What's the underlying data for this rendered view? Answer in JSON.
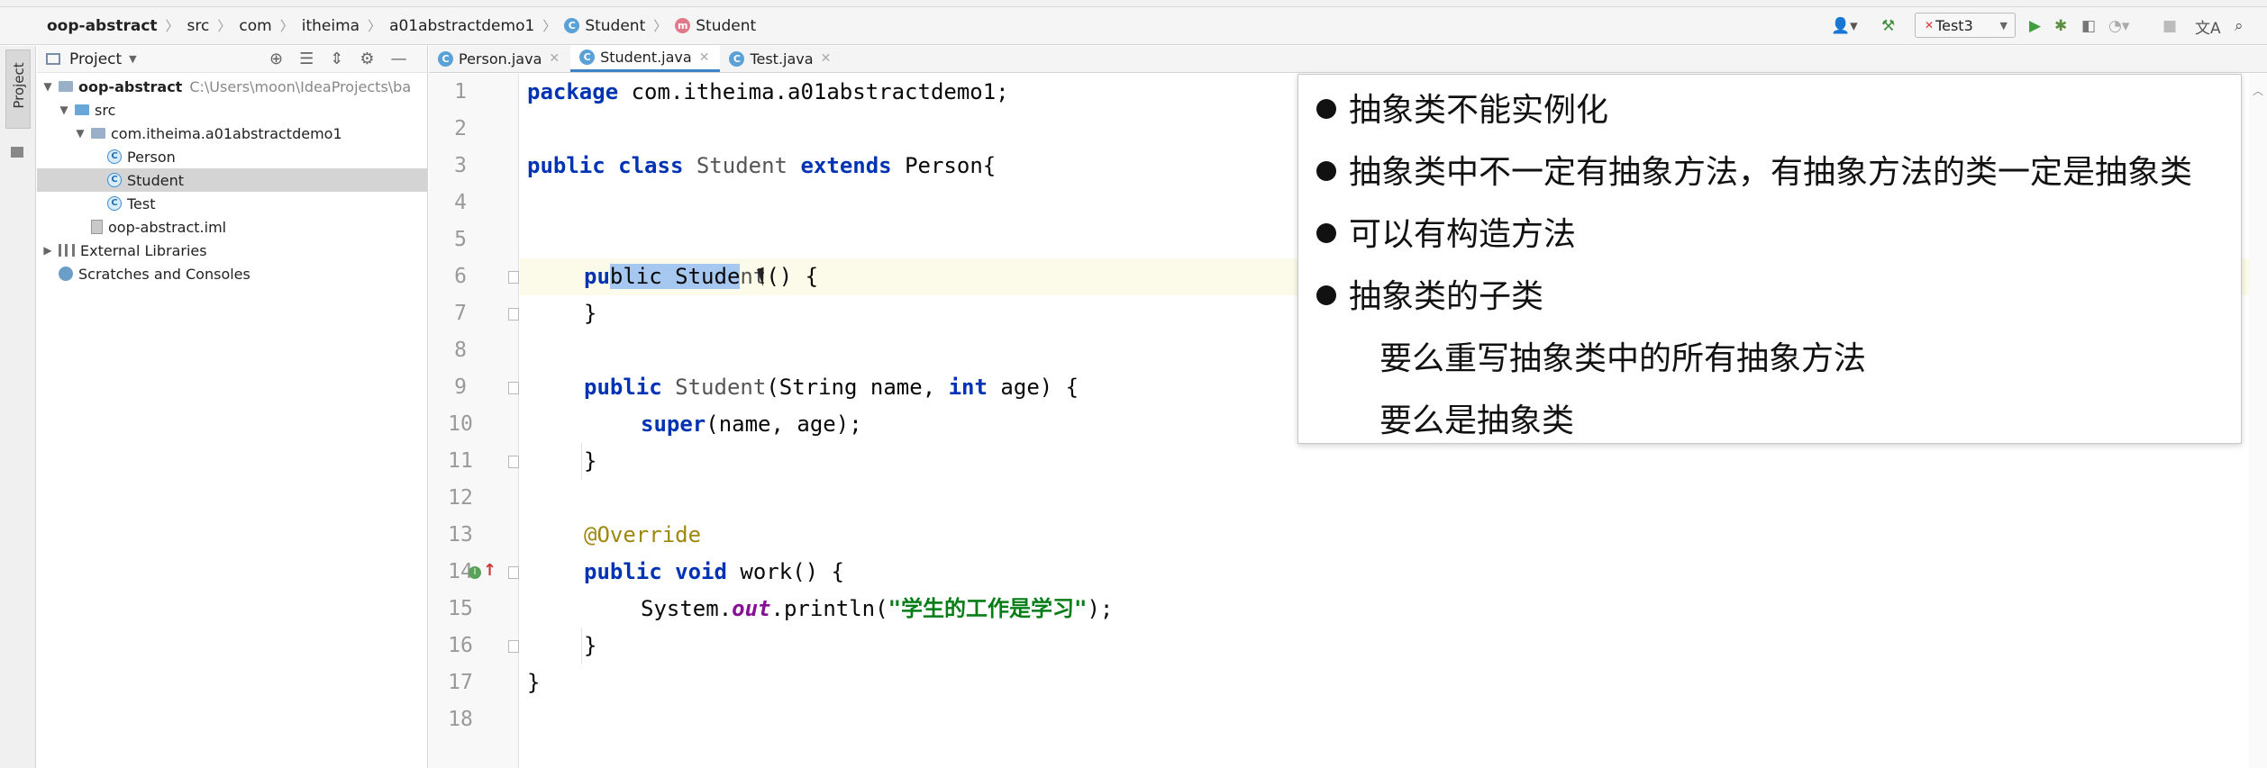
{
  "breadcrumb": [
    "oop-abstract",
    "src",
    "com",
    "itheima",
    "a01abstractdemo1",
    "Student",
    "Student"
  ],
  "toolbar": {
    "run_config": "Test3"
  },
  "sidebar": {
    "vertical_tab": "Project",
    "header_title": "Project",
    "tree": [
      {
        "label": "oop-abstract",
        "extra": "C:\\Users\\moon\\IdeaProjects\\ba"
      },
      {
        "label": "src"
      },
      {
        "label": "com.itheima.a01abstractdemo1"
      },
      {
        "label": "Person"
      },
      {
        "label": "Student"
      },
      {
        "label": "Test"
      },
      {
        "label": "oop-abstract.iml"
      },
      {
        "label": "External Libraries"
      },
      {
        "label": "Scratches and Consoles"
      }
    ]
  },
  "tabs": [
    {
      "label": "Person.java"
    },
    {
      "label": "Student.java"
    },
    {
      "label": "Test.java"
    }
  ],
  "code": {
    "line_numbers": [
      "1",
      "2",
      "3",
      "4",
      "5",
      "6",
      "7",
      "8",
      "9",
      "10",
      "11",
      "12",
      "13",
      "14",
      "15",
      "16",
      "17",
      "18"
    ],
    "l1_kw": "package",
    "l1_rest": " com.itheima.a01abstractdemo1;",
    "l3_kw1": "public",
    "l3_kw2": "class",
    "l3_cls": "Student",
    "l3_kw3": "extends",
    "l3_rest": " Person{",
    "l6_a": "pu",
    "l6_sel": "blic Stude",
    "l6_b": "nt",
    "l6_rest": "() {",
    "l7": "}",
    "l9_kw": "public",
    "l9_cls": "Student",
    "l9_a": "(String name, ",
    "l9_kw2": "int",
    "l9_b": " age) {",
    "l10_kw": "super",
    "l10_rest": "(name, age);",
    "l11": "}",
    "l13_ann": "@Override",
    "l14_kw1": "public",
    "l14_kw2": "void",
    "l14_rest": " work() {",
    "l15_a": "System.",
    "l15_fld": "out",
    "l15_b": ".println(",
    "l15_str": "\"学生的工作是学习\"",
    "l15_c": ");",
    "l16": "}",
    "l17": "}"
  },
  "overlay": {
    "items": [
      "抽象类不能实例化",
      "抽象类中不一定有抽象方法，有抽象方法的类一定是抽象类",
      "可以有构造方法",
      "抽象类的子类"
    ],
    "sub_items": [
      "要么重写抽象类中的所有抽象方法",
      "要么是抽象类"
    ]
  }
}
